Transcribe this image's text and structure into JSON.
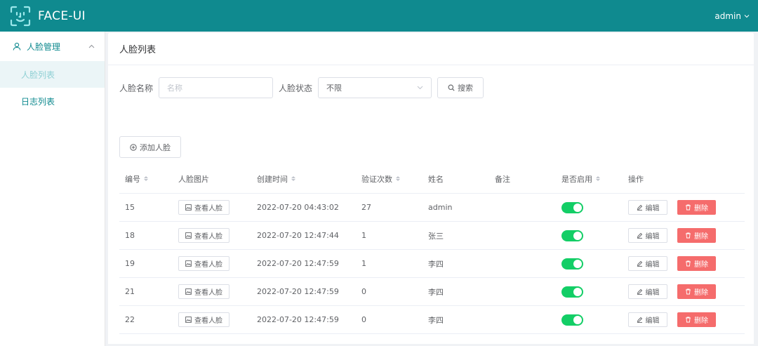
{
  "header": {
    "brand": "FACE-UI",
    "user": "admin"
  },
  "sidebar": {
    "group": {
      "label": "人脸管理",
      "icon": "user-icon"
    },
    "items": [
      {
        "label": "人脸列表",
        "active": true
      },
      {
        "label": "日志列表",
        "active": false
      }
    ]
  },
  "page": {
    "title": "人脸列表"
  },
  "filter": {
    "name_label": "人脸名称",
    "name_placeholder": "名称",
    "name_value": "",
    "status_label": "人脸状态",
    "status_value": "不限",
    "search_label": "搜索"
  },
  "add_button": "添加人脸",
  "table": {
    "columns": [
      "编号",
      "人脸图片",
      "创建时间",
      "验证次数",
      "姓名",
      "备注",
      "是否启用",
      "操作"
    ],
    "view_label": "查看人脸",
    "edit_label": "编辑",
    "delete_label": "删除",
    "rows": [
      {
        "id": "15",
        "created": "2022-07-20 04:43:02",
        "count": "27",
        "name": "admin",
        "note": "",
        "enabled": true
      },
      {
        "id": "18",
        "created": "2022-07-20 12:47:44",
        "count": "1",
        "name": "张三",
        "note": "",
        "enabled": true
      },
      {
        "id": "19",
        "created": "2022-07-20 12:47:59",
        "count": "1",
        "name": "李四",
        "note": "",
        "enabled": true
      },
      {
        "id": "21",
        "created": "2022-07-20 12:47:59",
        "count": "0",
        "name": "李四",
        "note": "",
        "enabled": true
      },
      {
        "id": "22",
        "created": "2022-07-20 12:47:59",
        "count": "0",
        "name": "李四",
        "note": "",
        "enabled": true
      }
    ]
  },
  "colors": {
    "primary": "#0f8a8f",
    "switch_on": "#13ce66",
    "danger": "#f56c6c"
  }
}
